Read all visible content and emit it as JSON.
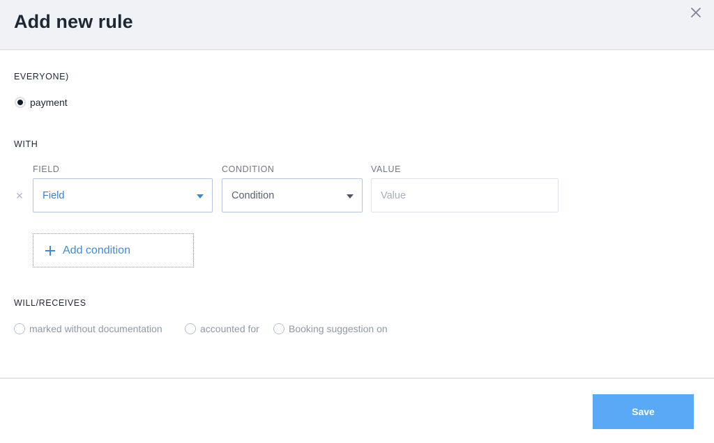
{
  "dialog": {
    "title": "Add new rule"
  },
  "who": {
    "label": "EVERYONE)",
    "option": {
      "label": "payment",
      "checked": true
    }
  },
  "with": {
    "label": "WITH",
    "columns": {
      "field": "FIELD",
      "condition": "CONDITION",
      "value": "VALUE"
    },
    "row": {
      "field_selected": "Field",
      "condition_selected": "Condition",
      "value_placeholder": "Value",
      "value": ""
    },
    "add_condition_label": "Add condition"
  },
  "receives": {
    "label": "WILL/RECEIVES",
    "options": [
      {
        "label": "marked without documentation",
        "checked": false
      },
      {
        "label": "accounted for",
        "checked": false
      },
      {
        "label": "Booking suggestion on",
        "checked": false
      }
    ]
  },
  "footer": {
    "save_label": "Save"
  },
  "icons": {
    "close": "close-icon",
    "remove": "remove-condition-icon",
    "plus": "plus-icon",
    "caret": "chevron-down-icon"
  },
  "colors": {
    "header_bg": "#f1f2f6",
    "accent": "#3f8ad8",
    "save_bg": "#5aa9f6"
  }
}
